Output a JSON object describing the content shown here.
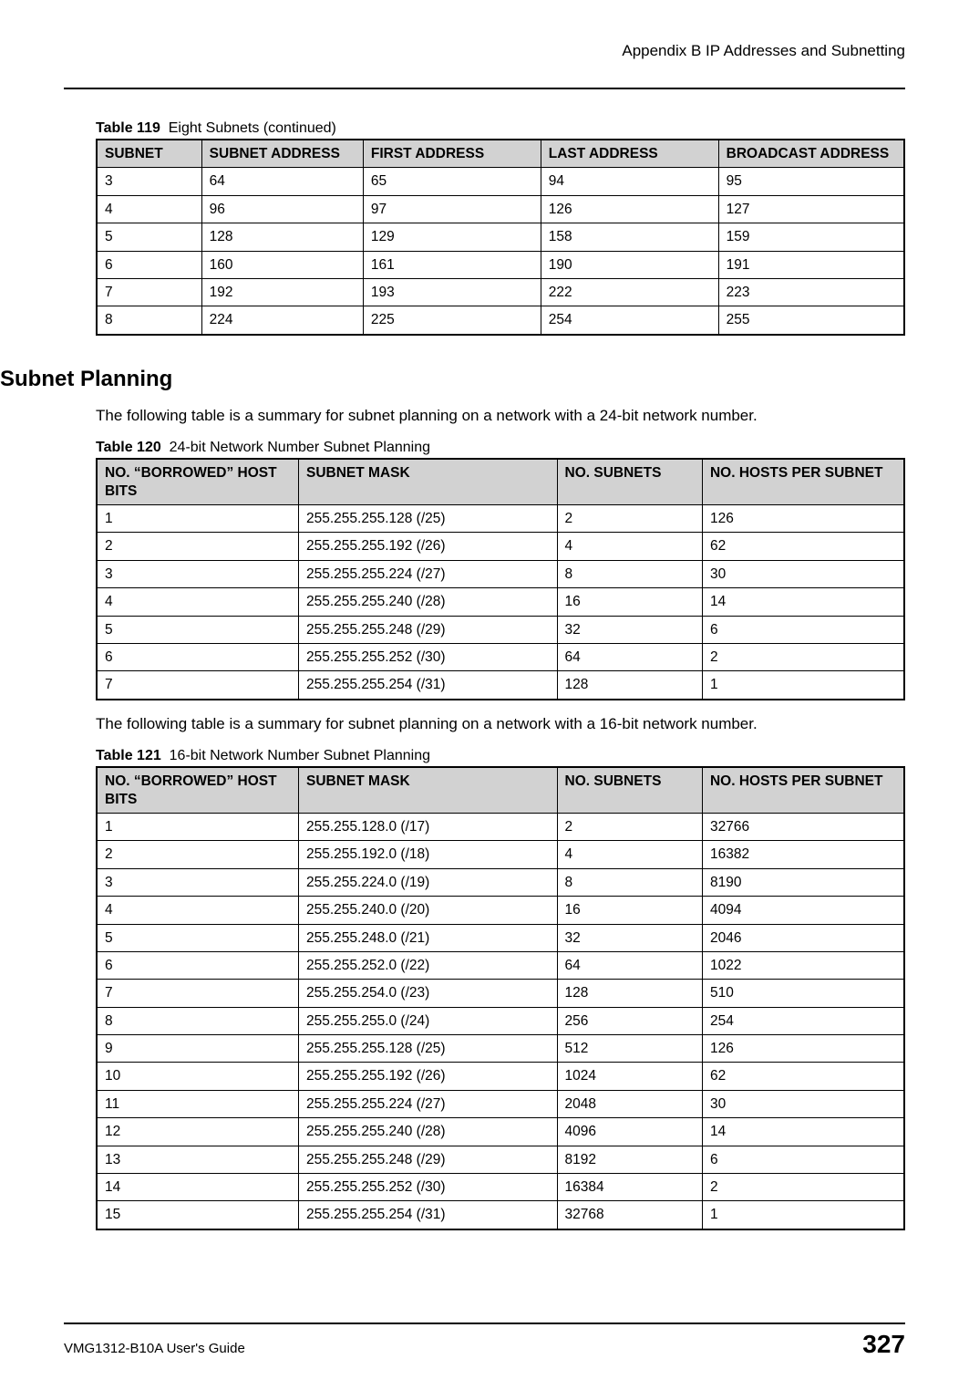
{
  "header": {
    "running_title": "Appendix B IP Addresses and Subnetting"
  },
  "footer": {
    "guide": "VMG1312-B10A User's Guide",
    "page": "327"
  },
  "table119": {
    "caption_num": "Table 119",
    "caption_text": "Eight Subnets (continued)",
    "headers": [
      "SUBNET",
      "SUBNET ADDRESS",
      "FIRST ADDRESS",
      "LAST ADDRESS",
      "BROADCAST ADDRESS"
    ],
    "rows": [
      [
        "3",
        "64",
        "65",
        "94",
        "95"
      ],
      [
        "4",
        "96",
        "97",
        "126",
        "127"
      ],
      [
        "5",
        "128",
        "129",
        "158",
        "159"
      ],
      [
        "6",
        "160",
        "161",
        "190",
        "191"
      ],
      [
        "7",
        "192",
        "193",
        "222",
        "223"
      ],
      [
        "8",
        "224",
        "225",
        "254",
        "255"
      ]
    ]
  },
  "section_heading": "Subnet Planning",
  "para1": "The following table is a summary for subnet planning on a network with a 24-bit network number.",
  "table120": {
    "caption_num": "Table 120",
    "caption_text": "24-bit Network Number Subnet Planning",
    "headers": [
      "NO. “BORROWED” HOST BITS",
      "SUBNET MASK",
      "NO. SUBNETS",
      "NO. HOSTS PER SUBNET"
    ],
    "rows": [
      [
        "1",
        "255.255.255.128 (/25)",
        "2",
        "126"
      ],
      [
        "2",
        "255.255.255.192 (/26)",
        "4",
        "62"
      ],
      [
        "3",
        "255.255.255.224 (/27)",
        "8",
        "30"
      ],
      [
        "4",
        "255.255.255.240 (/28)",
        "16",
        "14"
      ],
      [
        "5",
        "255.255.255.248 (/29)",
        "32",
        "6"
      ],
      [
        "6",
        "255.255.255.252 (/30)",
        "64",
        "2"
      ],
      [
        "7",
        "255.255.255.254 (/31)",
        "128",
        "1"
      ]
    ]
  },
  "para2": "The following table is a summary for subnet planning on a network with a 16-bit network number.",
  "table121": {
    "caption_num": "Table 121",
    "caption_text": "16-bit Network Number Subnet Planning",
    "headers": [
      "NO. “BORROWED” HOST BITS",
      "SUBNET MASK",
      "NO. SUBNETS",
      "NO. HOSTS PER SUBNET"
    ],
    "rows": [
      [
        "1",
        "255.255.128.0 (/17)",
        "2",
        "32766"
      ],
      [
        "2",
        "255.255.192.0 (/18)",
        "4",
        "16382"
      ],
      [
        "3",
        "255.255.224.0 (/19)",
        "8",
        "8190"
      ],
      [
        "4",
        "255.255.240.0 (/20)",
        "16",
        "4094"
      ],
      [
        "5",
        "255.255.248.0 (/21)",
        "32",
        "2046"
      ],
      [
        "6",
        "255.255.252.0 (/22)",
        "64",
        "1022"
      ],
      [
        "7",
        "255.255.254.0 (/23)",
        "128",
        "510"
      ],
      [
        "8",
        "255.255.255.0 (/24)",
        "256",
        "254"
      ],
      [
        "9",
        "255.255.255.128 (/25)",
        "512",
        "126"
      ],
      [
        "10",
        "255.255.255.192 (/26)",
        "1024",
        "62"
      ],
      [
        "11",
        "255.255.255.224 (/27)",
        "2048",
        "30"
      ],
      [
        "12",
        "255.255.255.240 (/28)",
        "4096",
        "14"
      ],
      [
        "13",
        "255.255.255.248 (/29)",
        "8192",
        "6"
      ],
      [
        "14",
        "255.255.255.252 (/30)",
        "16384",
        "2"
      ],
      [
        "15",
        "255.255.255.254 (/31)",
        "32768",
        "1"
      ]
    ]
  },
  "chart_data": [
    {
      "type": "table",
      "title": "Table 119 Eight Subnets (continued)",
      "columns": [
        "SUBNET",
        "SUBNET ADDRESS",
        "FIRST ADDRESS",
        "LAST ADDRESS",
        "BROADCAST ADDRESS"
      ],
      "rows": [
        [
          3,
          64,
          65,
          94,
          95
        ],
        [
          4,
          96,
          97,
          126,
          127
        ],
        [
          5,
          128,
          129,
          158,
          159
        ],
        [
          6,
          160,
          161,
          190,
          191
        ],
        [
          7,
          192,
          193,
          222,
          223
        ],
        [
          8,
          224,
          225,
          254,
          255
        ]
      ]
    },
    {
      "type": "table",
      "title": "Table 120 24-bit Network Number Subnet Planning",
      "columns": [
        "NO. BORROWED HOST BITS",
        "SUBNET MASK",
        "NO. SUBNETS",
        "NO. HOSTS PER SUBNET"
      ],
      "rows": [
        [
          1,
          "255.255.255.128 (/25)",
          2,
          126
        ],
        [
          2,
          "255.255.255.192 (/26)",
          4,
          62
        ],
        [
          3,
          "255.255.255.224 (/27)",
          8,
          30
        ],
        [
          4,
          "255.255.255.240 (/28)",
          16,
          14
        ],
        [
          5,
          "255.255.255.248 (/29)",
          32,
          6
        ],
        [
          6,
          "255.255.255.252 (/30)",
          64,
          2
        ],
        [
          7,
          "255.255.255.254 (/31)",
          128,
          1
        ]
      ]
    },
    {
      "type": "table",
      "title": "Table 121 16-bit Network Number Subnet Planning",
      "columns": [
        "NO. BORROWED HOST BITS",
        "SUBNET MASK",
        "NO. SUBNETS",
        "NO. HOSTS PER SUBNET"
      ],
      "rows": [
        [
          1,
          "255.255.128.0 (/17)",
          2,
          32766
        ],
        [
          2,
          "255.255.192.0 (/18)",
          4,
          16382
        ],
        [
          3,
          "255.255.224.0 (/19)",
          8,
          8190
        ],
        [
          4,
          "255.255.240.0 (/20)",
          16,
          4094
        ],
        [
          5,
          "255.255.248.0 (/21)",
          32,
          2046
        ],
        [
          6,
          "255.255.252.0 (/22)",
          64,
          1022
        ],
        [
          7,
          "255.255.254.0 (/23)",
          128,
          510
        ],
        [
          8,
          "255.255.255.0 (/24)",
          256,
          254
        ],
        [
          9,
          "255.255.255.128 (/25)",
          512,
          126
        ],
        [
          10,
          "255.255.255.192 (/26)",
          1024,
          62
        ],
        [
          11,
          "255.255.255.224 (/27)",
          2048,
          30
        ],
        [
          12,
          "255.255.255.240 (/28)",
          4096,
          14
        ],
        [
          13,
          "255.255.255.248 (/29)",
          8192,
          6
        ],
        [
          14,
          "255.255.255.252 (/30)",
          16384,
          2
        ],
        [
          15,
          "255.255.255.254 (/31)",
          32768,
          1
        ]
      ]
    }
  ]
}
